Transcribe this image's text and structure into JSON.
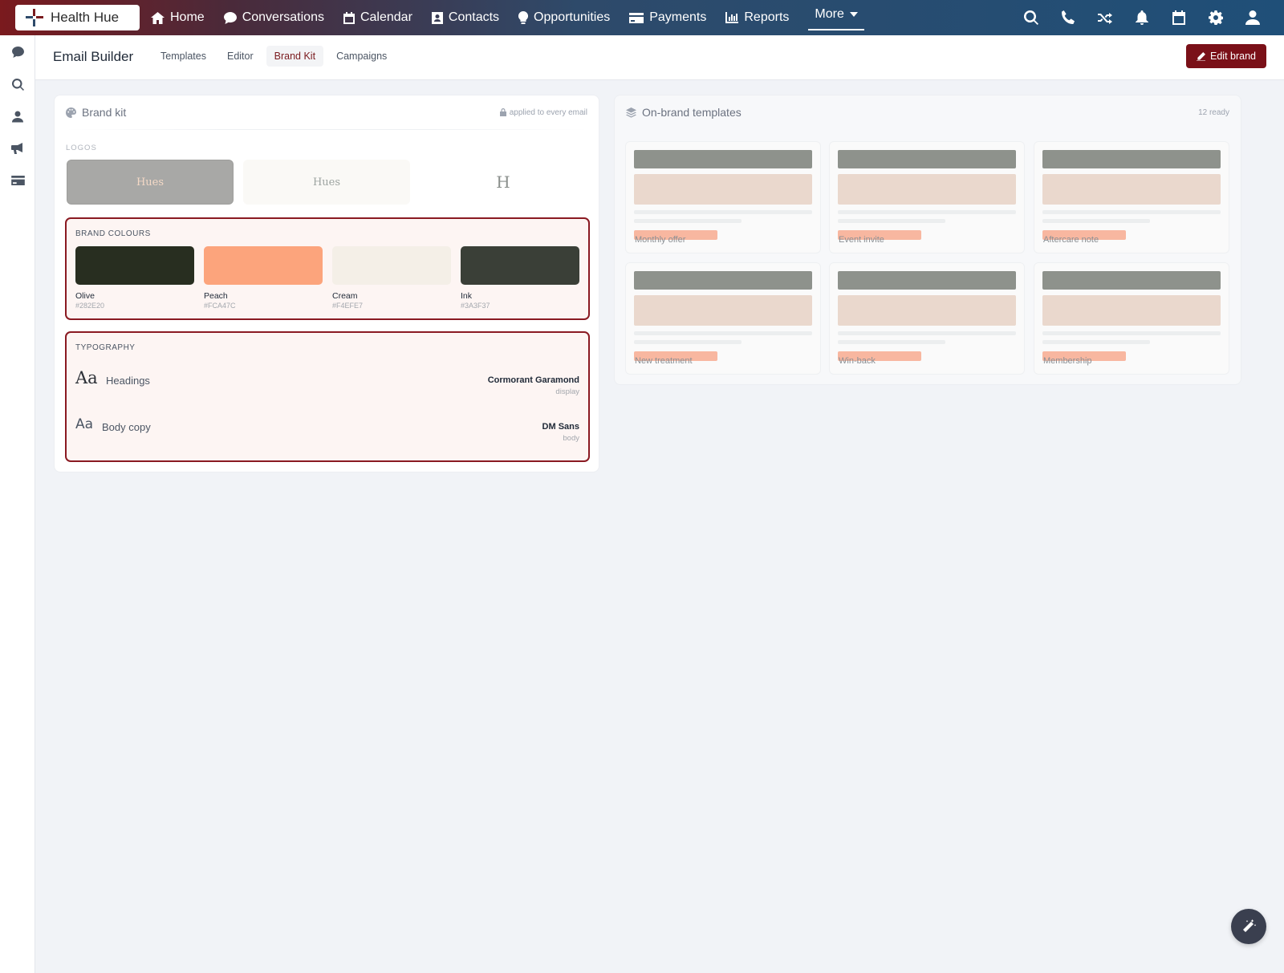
{
  "app": {
    "name": "Health Hue"
  },
  "nav": {
    "items": [
      {
        "label": "Home",
        "icon": "home-icon"
      },
      {
        "label": "Conversations",
        "icon": "chat-icon"
      },
      {
        "label": "Calendar",
        "icon": "calendar-icon"
      },
      {
        "label": "Contacts",
        "icon": "contacts-icon"
      },
      {
        "label": "Opportunities",
        "icon": "lightbulb-icon"
      },
      {
        "label": "Payments",
        "icon": "card-icon"
      },
      {
        "label": "Reports",
        "icon": "bar-chart-icon"
      }
    ],
    "more_label": "More",
    "right_icons": [
      "search-icon",
      "phone-icon",
      "shuffle-icon",
      "bell-icon",
      "calendar-icon",
      "gear-icon",
      "user-icon"
    ]
  },
  "rail": {
    "icons": [
      "chat-icon",
      "search-icon",
      "user-icon",
      "megaphone-icon",
      "card-icon"
    ]
  },
  "subheader": {
    "title": "Email Builder",
    "tabs": [
      {
        "label": "Templates",
        "active": false
      },
      {
        "label": "Editor",
        "active": false
      },
      {
        "label": "Brand Kit",
        "active": true
      },
      {
        "label": "Campaigns",
        "active": false
      }
    ],
    "edit_button": "Edit brand"
  },
  "brand_kit": {
    "title": "Brand kit",
    "meta": "applied to every email",
    "logos_label": "LOGOS",
    "logos": [
      "Hues",
      "Hues",
      "H"
    ],
    "colours_label": "BRAND COLOURS",
    "colours": [
      {
        "name": "Olive",
        "hex": "#282E20"
      },
      {
        "name": "Peach",
        "hex": "#FCA47C"
      },
      {
        "name": "Cream",
        "hex": "#F4EFE7"
      },
      {
        "name": "Ink",
        "hex": "#3A3F37"
      }
    ],
    "typography_label": "TYPOGRAPHY",
    "typography": [
      {
        "sample": "Aa",
        "role": "Headings",
        "font": "Cormorant Garamond",
        "kind": "display"
      },
      {
        "sample": "Aa",
        "role": "Body copy",
        "font": "DM Sans",
        "kind": "body"
      }
    ]
  },
  "templates": {
    "title": "On-brand templates",
    "meta": "12 ready",
    "items": [
      "Monthly offer",
      "Event invite",
      "Aftercare note",
      "New treatment",
      "Win-back",
      "Membership"
    ]
  },
  "colors": {
    "accent": "#7a1018",
    "peach": "#FCA47C"
  }
}
